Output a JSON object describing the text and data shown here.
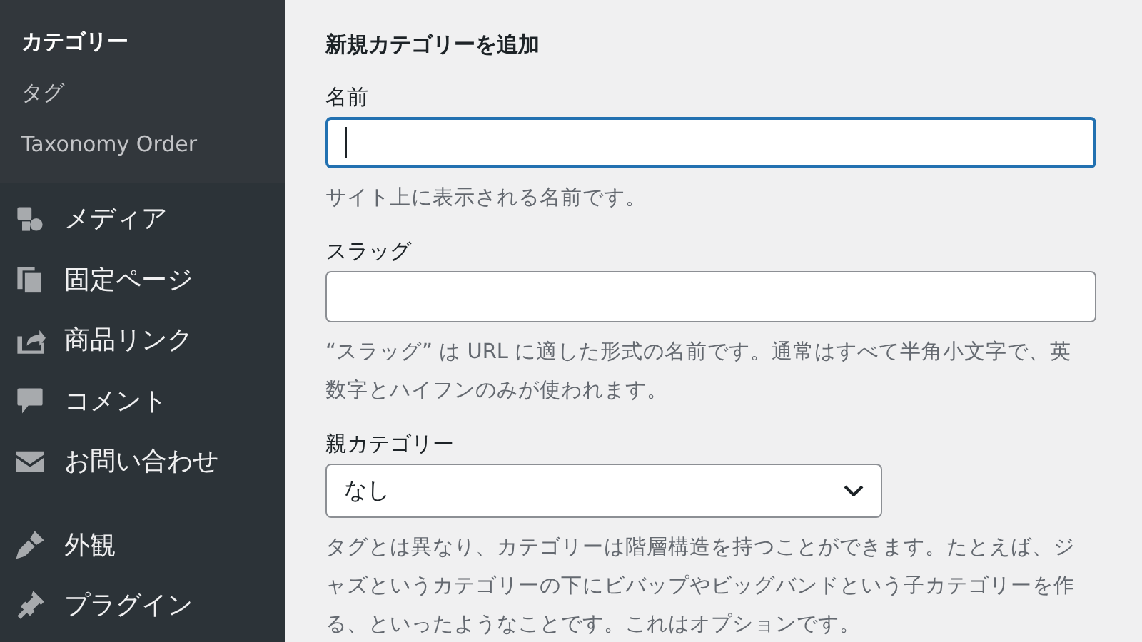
{
  "sidebar": {
    "submenu": [
      {
        "label": "カテゴリー",
        "selected": true
      },
      {
        "label": "タグ",
        "selected": false
      },
      {
        "label": "Taxonomy Order",
        "selected": false
      }
    ],
    "menu": [
      {
        "label": "メディア"
      },
      {
        "label": "固定ページ"
      },
      {
        "label": "商品リンク"
      },
      {
        "label": "コメント"
      },
      {
        "label": "お問い合わせ"
      }
    ],
    "menu_2": [
      {
        "label": "外観"
      },
      {
        "label": "プラグイン"
      }
    ]
  },
  "form": {
    "title": "新規カテゴリーを追加",
    "name_field": {
      "label": "名前",
      "focused": true,
      "help": "サイト上に表示される名前です。"
    },
    "slug_field": {
      "label": "スラッグ",
      "focused": false,
      "help": "“スラッグ” は URL に適した形式の名前です。通常はすべて半角小文字で、英数字とハイフンのみが使われます。"
    },
    "parent_field": {
      "label": "親カテゴリー",
      "value": "なし",
      "help": "タグとは異なり、カテゴリーは階層構造を持つことができます。たとえば、ジャズというカテゴリーの下にビバップやビッグバンドという子カテゴリーを作る、といったようなことです。これはオプションです。"
    }
  }
}
